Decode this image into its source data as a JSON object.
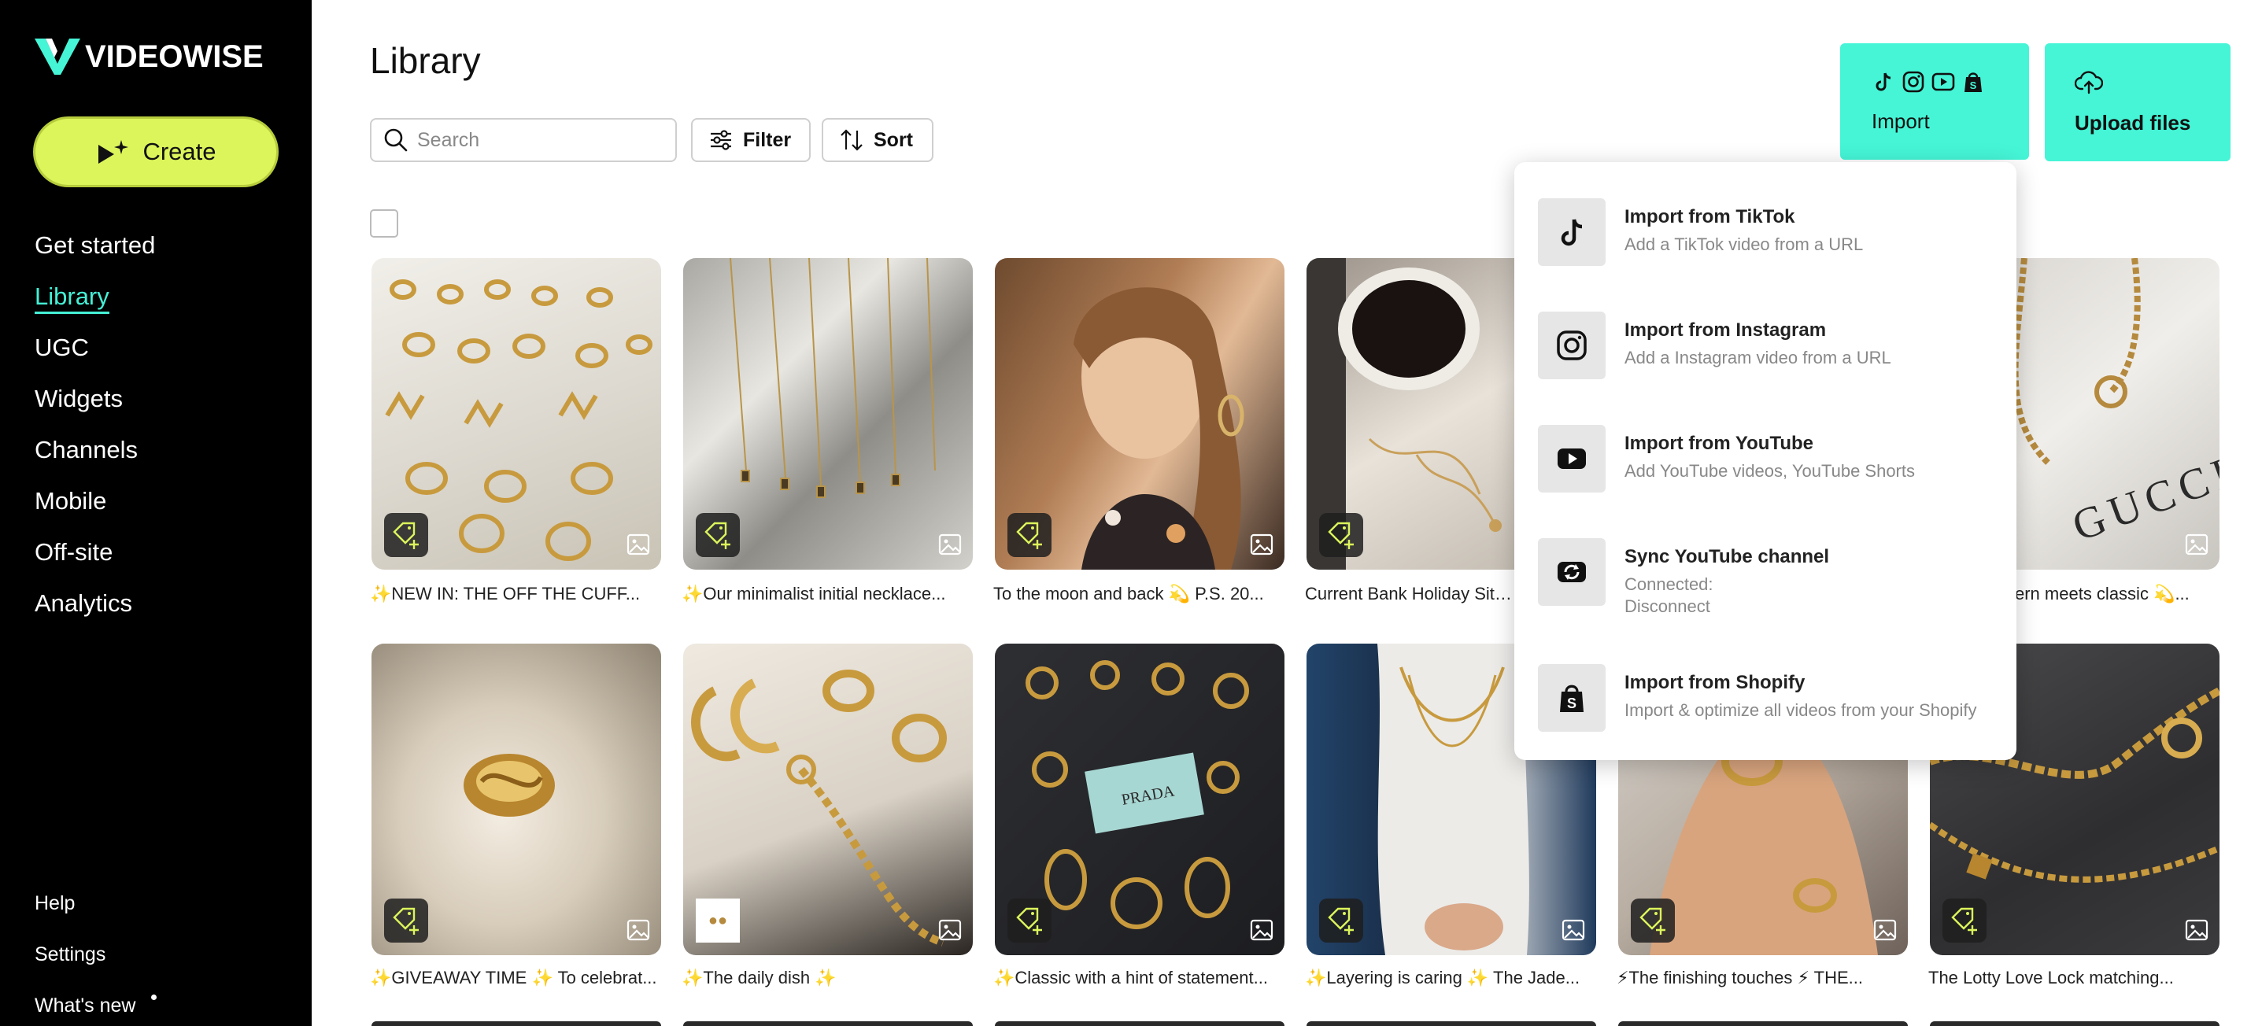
{
  "brand": {
    "name": "VIDEOWISE",
    "accent": "#45f5d6",
    "create_color": "#dcf55b"
  },
  "sidebar": {
    "create_label": "Create",
    "items": [
      {
        "label": "Get started"
      },
      {
        "label": "Library",
        "active": true
      },
      {
        "label": "UGC"
      },
      {
        "label": "Widgets"
      },
      {
        "label": "Channels"
      },
      {
        "label": "Mobile"
      },
      {
        "label": "Off-site"
      },
      {
        "label": "Analytics"
      }
    ],
    "bottom": [
      {
        "label": "Help"
      },
      {
        "label": "Settings"
      },
      {
        "label": "What's new"
      }
    ]
  },
  "main": {
    "title": "Library",
    "search_placeholder": "Search",
    "filter_label": "Filter",
    "sort_label": "Sort",
    "import_label": "Import",
    "upload_label": "Upload files"
  },
  "import_menu": [
    {
      "title": "Import from TikTok",
      "desc": "Add a TikTok video from a URL",
      "icon": "tiktok-icon"
    },
    {
      "title": "Import from Instagram",
      "desc": "Add a Instagram video from a URL",
      "icon": "instagram-icon"
    },
    {
      "title": "Import from YouTube",
      "desc": "Add YouTube videos, YouTube Shorts",
      "icon": "youtube-icon"
    },
    {
      "title": "Sync YouTube channel",
      "desc": "Connected:",
      "desc2": "Disconnect",
      "icon": "sync-icon"
    },
    {
      "title": "Import from Shopify",
      "desc": "Import & optimize all videos from your Shopify",
      "icon": "shopify-icon"
    }
  ],
  "cards": [
    {
      "caption": "✨NEW IN: THE OFF THE CUFF..."
    },
    {
      "caption": "✨Our minimalist initial necklace..."
    },
    {
      "caption": "To the moon and back 💫 P.S. 20..."
    },
    {
      "caption": "Current Bank Holiday Situa"
    },
    {
      "caption": ""
    },
    {
      "caption": "ern meets classic 💫..."
    },
    {
      "caption": "✨GIVEAWAY TIME ✨ To celebrat..."
    },
    {
      "caption": "✨The daily dish ✨"
    },
    {
      "caption": "✨Classic with a hint of statement..."
    },
    {
      "caption": "✨Layering is caring ✨ The Jade..."
    },
    {
      "caption": "⚡The finishing touches ⚡ THE..."
    },
    {
      "caption": "The Lotty Love Lock matching..."
    }
  ]
}
